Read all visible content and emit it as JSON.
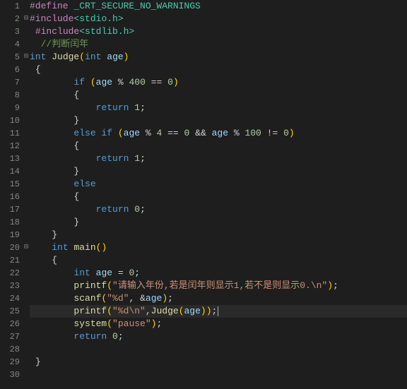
{
  "gutter": {
    "lines": [
      "1",
      "2",
      "3",
      "4",
      "5",
      "6",
      "7",
      "8",
      "9",
      "10",
      "11",
      "12",
      "13",
      "14",
      "15",
      "16",
      "17",
      "18",
      "19",
      "20",
      "21",
      "22",
      "23",
      "24",
      "25",
      "26",
      "27",
      "28",
      "29",
      "30"
    ]
  },
  "fold": {
    "marks": [
      "",
      "⊟",
      "",
      "",
      "⊟",
      "",
      "",
      "",
      "",
      "",
      "",
      "",
      "",
      "",
      "",
      "",
      "",
      "",
      "",
      "⊟",
      "",
      "",
      "",
      "",
      "",
      "",
      "",
      "",
      "",
      ""
    ]
  },
  "code": {
    "l1": {
      "define_kw": "#define",
      "macro": " _CRT_SECURE_NO_WARNINGS"
    },
    "l2": {
      "include_kw": "#include",
      "open": "<",
      "header": "stdio.h",
      "close": ">"
    },
    "l3": {
      "indent": " ",
      "include_kw": "#include",
      "open": "<",
      "header": "stdlib.h",
      "close": ">"
    },
    "l4": {
      "indent": "  ",
      "comment": "//判断闰年"
    },
    "l5": {
      "type": "int",
      "sp": " ",
      "func": "Judge",
      "lp": "(",
      "ptype": "int",
      "sp2": " ",
      "param": "age",
      "rp": ")"
    },
    "l6": {
      "indent": " ",
      "brace": "{"
    },
    "l7": {
      "indent": "        ",
      "kw": "if",
      "sp": " ",
      "lp": "(",
      "var": "age",
      "sp2": " ",
      "op": "%",
      "sp3": " ",
      "num": "400",
      "sp4": " ",
      "eq": "==",
      "sp5": " ",
      "zero": "0",
      "rp": ")"
    },
    "l8": {
      "indent": "        ",
      "brace": "{"
    },
    "l9": {
      "indent": "            ",
      "kw": "return",
      "sp": " ",
      "num": "1",
      "semi": ";"
    },
    "l10": {
      "indent": "        ",
      "brace": "}"
    },
    "l11": {
      "indent": "        ",
      "kw": "else if",
      "sp": " ",
      "lp": "(",
      "var": "age",
      "sp2": " ",
      "op": "%",
      "sp3": " ",
      "num4": "4",
      "sp4": " ",
      "eq": "==",
      "sp5": " ",
      "zero": "0",
      "sp6": " ",
      "and": "&&",
      "sp7": " ",
      "var2": "age",
      "sp8": " ",
      "op2": "%",
      "sp9": " ",
      "num100": "100",
      "sp10": " ",
      "neq": "!=",
      "sp11": " ",
      "zero2": "0",
      "rp": ")"
    },
    "l12": {
      "indent": "        ",
      "brace": "{"
    },
    "l13": {
      "indent": "            ",
      "kw": "return",
      "sp": " ",
      "num": "1",
      "semi": ";"
    },
    "l14": {
      "indent": "        ",
      "brace": "}"
    },
    "l15": {
      "indent": "        ",
      "kw": "else"
    },
    "l16": {
      "indent": "        ",
      "brace": "{"
    },
    "l17": {
      "indent": "            ",
      "kw": "return",
      "sp": " ",
      "num": "0",
      "semi": ";"
    },
    "l18": {
      "indent": "        ",
      "brace": "}"
    },
    "l19": {
      "indent": "    ",
      "brace": "}"
    },
    "l20": {
      "indent": "    ",
      "type": "int",
      "sp": " ",
      "func": "main",
      "lp": "(",
      "rp": ")"
    },
    "l21": {
      "indent": "    ",
      "brace": "{"
    },
    "l22": {
      "indent": "        ",
      "type": "int",
      "sp": " ",
      "var": "age",
      "sp2": " ",
      "eq": "=",
      "sp3": " ",
      "num": "0",
      "semi": ";"
    },
    "l23": {
      "indent": "        ",
      "func": "printf",
      "lp": "(",
      "str": "\"请输入年份,若是闰年则显示1,若不是则显示0.\\n\"",
      "rp": ")",
      "semi": ";"
    },
    "l24": {
      "indent": "        ",
      "func": "scanf",
      "lp": "(",
      "str": "\"%d\"",
      "comma": ",",
      "sp": " ",
      "amp": "&",
      "var": "age",
      "rp": ")",
      "semi": ";"
    },
    "l25": {
      "indent": "        ",
      "func": "printf",
      "lp": "(",
      "str": "\"%d\\n\"",
      "comma": ",",
      "func2": "Judge",
      "lp2": "(",
      "var": "age",
      "rp2": ")",
      "rp": ")",
      "semi": ";"
    },
    "l26": {
      "indent": "        ",
      "func": "system",
      "lp": "(",
      "str": "\"pause\"",
      "rp": ")",
      "semi": ";"
    },
    "l27": {
      "indent": "        ",
      "kw": "return",
      "sp": " ",
      "num": "0",
      "semi": ";"
    },
    "l28": {
      "indent": ""
    },
    "l29": {
      "indent": " ",
      "brace": "}"
    },
    "l30": {
      "indent": ""
    }
  }
}
